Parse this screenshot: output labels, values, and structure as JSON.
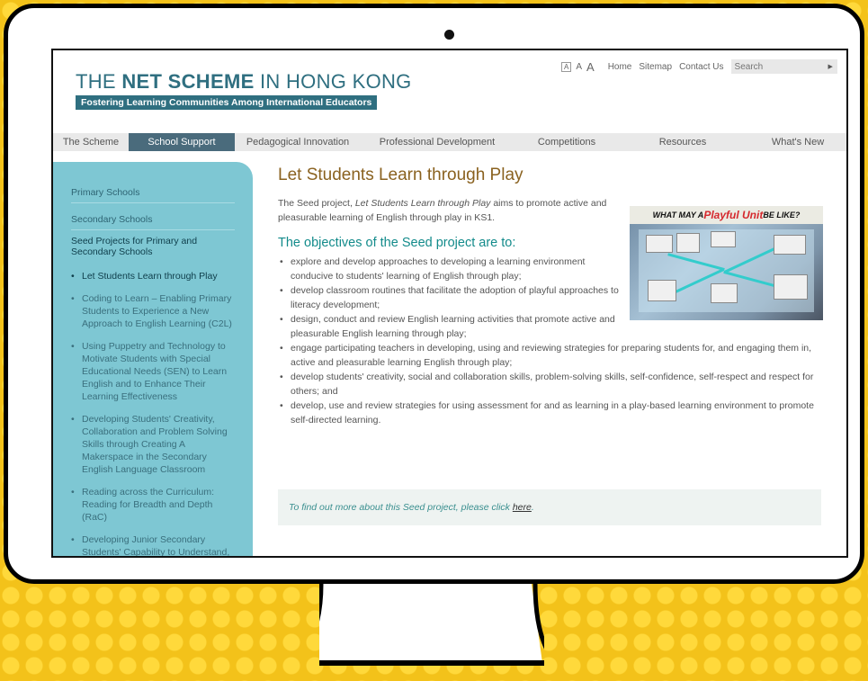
{
  "site": {
    "title_pre": "THE ",
    "title_bold": "NET SCHEME",
    "title_post": " IN HONG KONG",
    "subtitle": "Fostering Learning Communities Among International Educators"
  },
  "utility": {
    "font_small": "A",
    "font_medium": "A",
    "font_large": "A",
    "home": "Home",
    "sitemap": "Sitemap",
    "contact": "Contact Us",
    "search_placeholder": "Search"
  },
  "nav": [
    "The Scheme",
    "School Support",
    "Pedagogical Innovation",
    "Professional Development",
    "Competitions",
    "Resources",
    "What's New"
  ],
  "sidebar": {
    "links": [
      "Primary Schools",
      "Secondary Schools"
    ],
    "seed_heading": "Seed Projects for Primary and Secondary Schools",
    "items": [
      "Let Students Learn through Play",
      "Coding to Learn – Enabling Primary Students to Experience a New Approach to English Learning (C2L)",
      "Using Puppetry and Technology to Motivate Students with Special Educational Needs (SEN) to Learn English and to Enhance Their Learning Effectiveness",
      "Developing Students' Creativity, Collaboration and Problem Solving Skills through Creating A Makerspace in the Secondary English Language Classroom",
      "Reading across the Curriculum: Reading for Breadth and Depth (RaC)",
      "Developing Junior Secondary Students' Capability to Understand,"
    ]
  },
  "main": {
    "heading": "Let Students Learn through Play",
    "intro_pre": "The Seed project, ",
    "intro_italic": "Let Students Learn through Play",
    "intro_post": " aims to promote active and pleasurable learning of English through play in KS1.",
    "objectives_heading": "The objectives of the Seed project are to:",
    "objectives": [
      "explore and develop approaches to developing a learning environment conducive to students' learning of English through play;",
      "develop classroom routines that facilitate the adoption of playful approaches to literacy development;",
      "design, conduct and review English learning activities that promote active and pleasurable English learning through play;",
      "engage participating teachers in developing, using and reviewing strategies for preparing students for, and engaging them in, active and pleasurable learning English through play;",
      "develop students' creativity, social and collaboration skills, problem-solving skills, self-confidence, self-respect and respect for others; and",
      "develop, use and review strategies for using assessment for and as learning in a play-based learning environment to promote self-directed learning."
    ],
    "photo_title_pre": "WHAT MAY A ",
    "photo_title_red": "Playful Unit",
    "photo_title_post": " BE LIKE?",
    "findout_text": "To find out more about this Seed project, please click ",
    "findout_link": "here",
    "findout_end": "."
  },
  "colors": {
    "background": "#f3c21a",
    "brand": "#2f6f80",
    "sidebar": "#7ec7d3",
    "heading": "#8a6220",
    "subheading": "#138b8b"
  }
}
